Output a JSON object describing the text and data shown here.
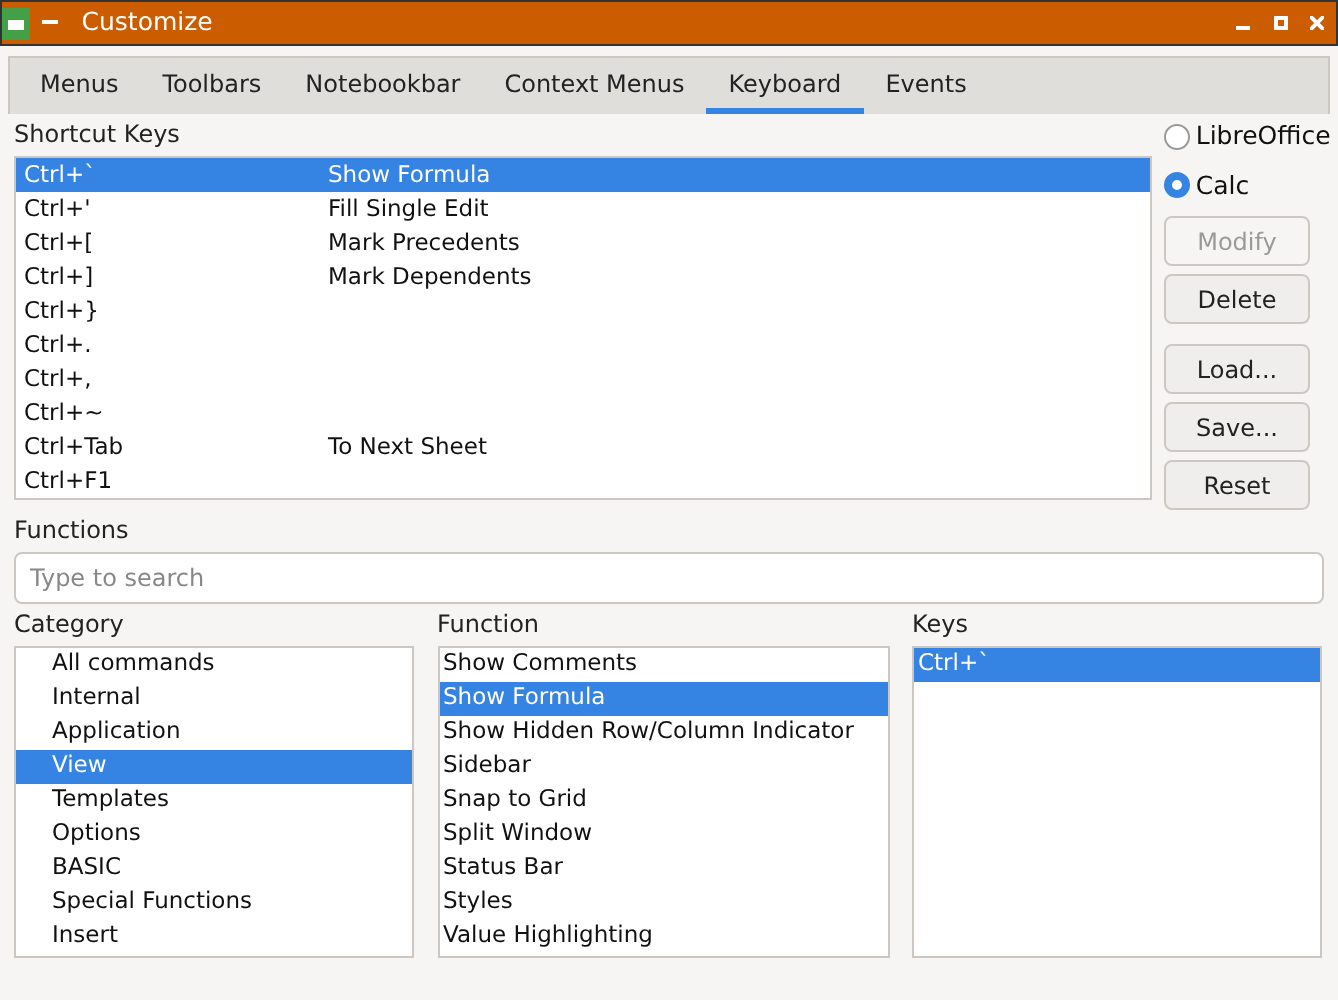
{
  "window": {
    "title": "Customize"
  },
  "tabs": [
    {
      "label": "Menus",
      "selected": false
    },
    {
      "label": "Toolbars",
      "selected": false
    },
    {
      "label": "Notebookbar",
      "selected": false
    },
    {
      "label": "Context Menus",
      "selected": false
    },
    {
      "label": "Keyboard",
      "selected": true
    },
    {
      "label": "Events",
      "selected": false
    }
  ],
  "shortcut_keys": {
    "label": "Shortcut Keys",
    "rows": [
      {
        "key": "Ctrl+`",
        "function": "Show Formula",
        "selected": true
      },
      {
        "key": "Ctrl+'",
        "function": "Fill Single Edit",
        "selected": false
      },
      {
        "key": "Ctrl+[",
        "function": "Mark Precedents",
        "selected": false
      },
      {
        "key": "Ctrl+]",
        "function": "Mark Dependents",
        "selected": false
      },
      {
        "key": "Ctrl+}",
        "selected": false
      },
      {
        "key": "Ctrl+.",
        "selected": false
      },
      {
        "key": "Ctrl+,",
        "selected": false
      },
      {
        "key": "Ctrl+~",
        "selected": false
      },
      {
        "key": "Ctrl+Tab",
        "function": "To Next Sheet",
        "selected": false
      },
      {
        "key": "Ctrl+F1",
        "selected": false
      }
    ]
  },
  "scope": [
    {
      "label": "LibreOffice",
      "selected": false
    },
    {
      "label": "Calc",
      "selected": true
    }
  ],
  "buttons": [
    {
      "label": "Modify",
      "disabled": true
    },
    {
      "label": "Delete",
      "disabled": false
    },
    {
      "label": "Load...",
      "disabled": false
    },
    {
      "label": "Save...",
      "disabled": false
    },
    {
      "label": "Reset",
      "disabled": false
    }
  ],
  "functions": {
    "label": "Functions",
    "search": {
      "placeholder": "Type to search"
    }
  },
  "category": {
    "label": "Category",
    "items": [
      {
        "label": "All commands",
        "selected": false
      },
      {
        "label": "Internal",
        "selected": false
      },
      {
        "label": "Application",
        "selected": false
      },
      {
        "label": "View",
        "selected": true
      },
      {
        "label": "Templates",
        "selected": false
      },
      {
        "label": "Options",
        "selected": false
      },
      {
        "label": "BASIC",
        "selected": false
      },
      {
        "label": "Special Functions",
        "selected": false
      },
      {
        "label": "Insert",
        "selected": false
      }
    ]
  },
  "function_list": {
    "label": "Function",
    "items": [
      {
        "label": "Show Comments",
        "selected": false
      },
      {
        "label": "Show Formula",
        "selected": true
      },
      {
        "label": "Show Hidden Row/Column Indicator",
        "selected": false
      },
      {
        "label": "Sidebar",
        "selected": false
      },
      {
        "label": "Snap to Grid",
        "selected": false
      },
      {
        "label": "Split Window",
        "selected": false
      },
      {
        "label": "Status Bar",
        "selected": false
      },
      {
        "label": "Styles",
        "selected": false
      },
      {
        "label": "Value Highlighting",
        "selected": false
      }
    ]
  },
  "keys": {
    "label": "Keys",
    "items": [
      {
        "label": "Ctrl+`",
        "selected": true
      }
    ]
  }
}
